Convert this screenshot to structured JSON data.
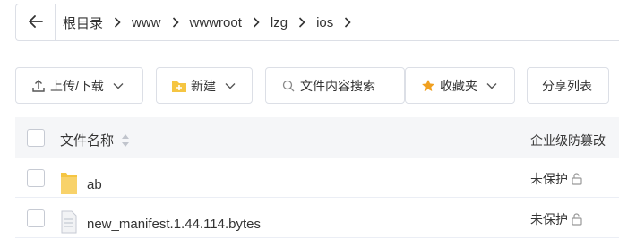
{
  "breadcrumb": {
    "items": [
      "根目录",
      "www",
      "wwwroot",
      "lzg",
      "ios"
    ]
  },
  "toolbar": {
    "upload_label": "上传/下载",
    "new_label": "新建",
    "search_label": "文件内容搜索",
    "favorites_label": "收藏夹",
    "share_label": "分享列表"
  },
  "table": {
    "headers": {
      "name": "文件名称",
      "protection": "企业级防篡改"
    },
    "rows": [
      {
        "name": "ab",
        "type": "folder",
        "protection": "未保护"
      },
      {
        "name": "new_manifest.1.44.114.bytes",
        "type": "file",
        "protection": "未保护"
      }
    ]
  },
  "colors": {
    "border": "#dcdfe6",
    "header_bg": "#f5f6f8",
    "folder": "#f5c542",
    "star": "#f0a020",
    "text": "#333333"
  }
}
